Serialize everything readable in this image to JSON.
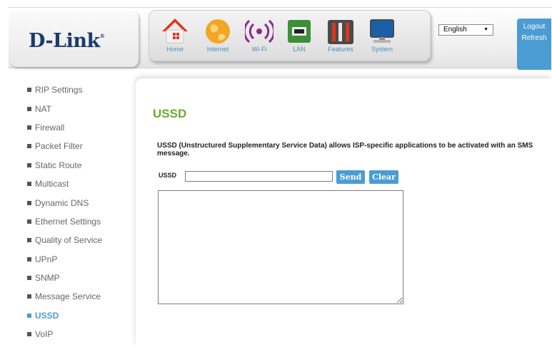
{
  "brand": {
    "logo": "D-Link",
    "registered": "®"
  },
  "nav": [
    {
      "label": "Home",
      "icon": "home-icon"
    },
    {
      "label": "Internet",
      "icon": "globe-icon"
    },
    {
      "label": "Wi-Fi",
      "icon": "wifi-icon"
    },
    {
      "label": "LAN",
      "icon": "lan-icon"
    },
    {
      "label": "Features",
      "icon": "tools-icon"
    },
    {
      "label": "System",
      "icon": "monitor-icon"
    }
  ],
  "language": {
    "selected": "English"
  },
  "account": {
    "logout": "Logout",
    "refresh": "Refresh"
  },
  "sidebar": {
    "items": [
      {
        "label": "RIP Settings"
      },
      {
        "label": "NAT"
      },
      {
        "label": "Firewall"
      },
      {
        "label": "Packet Filter"
      },
      {
        "label": "Static Route"
      },
      {
        "label": "Multicast"
      },
      {
        "label": "Dynamic DNS"
      },
      {
        "label": "Ethernet Settings"
      },
      {
        "label": "Quality of Service"
      },
      {
        "label": "UPnP"
      },
      {
        "label": "SNMP"
      },
      {
        "label": "Message Service"
      },
      {
        "label": "USSD",
        "active": true
      },
      {
        "label": "VoIP"
      }
    ]
  },
  "page": {
    "title": "USSD",
    "description": "USSD (Unstructured Supplementary Service Data) allows ISP-specific applications to be activated with an SMS message.",
    "field_label": "USSD",
    "field_value": "",
    "send_label": "Send",
    "clear_label": "Clear",
    "output": ""
  },
  "colors": {
    "accent": "#4b9cd3",
    "title_green": "#6aaa2e",
    "logo_blue": "#1a3c6e"
  }
}
